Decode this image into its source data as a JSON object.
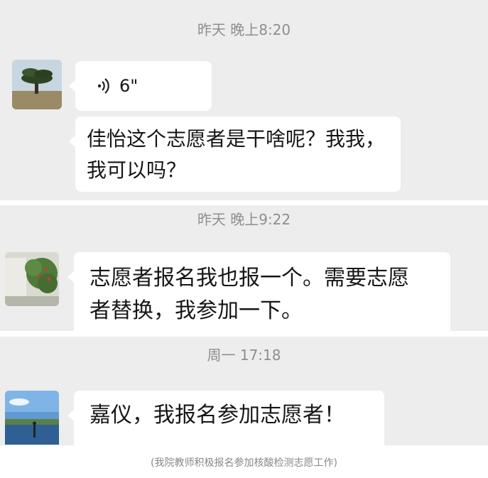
{
  "chat": {
    "timestamp_1": "昨天 晚上8:20",
    "voice_duration": "6\"",
    "message_1": "佳怡这个志愿者是干啥呢？我我，\n我可以吗？",
    "timestamp_2": "昨天 晚上9:22",
    "message_2": "志愿者报名我也报一个。需要志愿\n者替换，我参加一下。",
    "timestamp_3": "周一 17:18",
    "message_3": "嘉仪，我报名参加志愿者！"
  },
  "icons": {
    "voice": "voice-wave-icon"
  },
  "caption": "(我院教师积极报名参加核酸检测志愿工作)",
  "colors": {
    "chat_background": "#ededed",
    "bubble": "#ffffff",
    "timestamp_text": "#8e8e8e",
    "caption_text": "#888888"
  }
}
